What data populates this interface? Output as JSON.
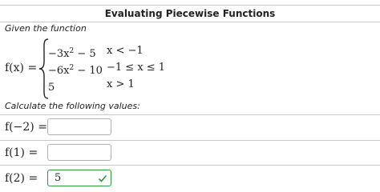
{
  "title": "Evaluating Piecewise Functions",
  "intro_text": "Given the function",
  "function": {
    "lhs": "f(x) =",
    "cases": [
      {
        "expr_base": "−3x",
        "expr_exp": "2",
        "expr_tail": " − 5",
        "condition": "x < −1"
      },
      {
        "expr_base": "−6x",
        "expr_exp": "2",
        "expr_tail": " − 10",
        "condition": "−1 ≤ x ≤ 1"
      },
      {
        "expr_base": "5",
        "expr_exp": "",
        "expr_tail": "",
        "condition": "x > 1"
      }
    ]
  },
  "calculate_text": "Calculate the following values:",
  "questions": [
    {
      "label": "f(−2) =",
      "value": "",
      "status": ""
    },
    {
      "label": "f(1) =",
      "value": "",
      "status": ""
    },
    {
      "label": "f(2) =",
      "value": "5",
      "status": "correct"
    }
  ],
  "colors": {
    "correct": "#2e9a3e",
    "border": "#b0b0b0",
    "rule": "#c8c8c8"
  },
  "icons": {
    "correct_status": "checkmark-icon"
  }
}
